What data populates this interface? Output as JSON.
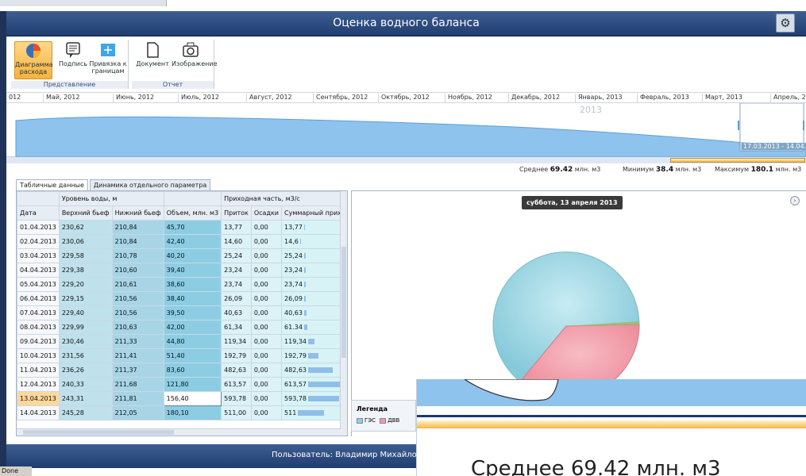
{
  "app": {
    "title": "Оценка водного баланса"
  },
  "ribbon": {
    "buttons": [
      {
        "label": "Диаграмма расхода",
        "icon": "pie-chart-icon"
      },
      {
        "label": "Подпись",
        "icon": "caption-icon"
      },
      {
        "label": "Привязка к границам",
        "icon": "snap-bounds-icon"
      },
      {
        "label": "Документ",
        "icon": "document-icon"
      },
      {
        "label": "Изображение",
        "icon": "camera-icon"
      }
    ],
    "groups": [
      "Представление",
      "Отчет"
    ]
  },
  "timeline": {
    "months": [
      "012",
      "Май, 2012",
      "Июнь, 2012",
      "Июль, 2012",
      "Август, 2012",
      "Сентябрь, 2012",
      "Октябрь, 2012",
      "Ноябрь, 2012",
      "Декабрь, 2012",
      "Январь, 2013",
      "Февраль, 2013",
      "Март, 2013",
      "Апрель, 2"
    ],
    "year_label": "2013",
    "range_label": "17.03.2013 - 14.04.",
    "stats": {
      "avg_label": "Среднее",
      "avg_value": "69.42",
      "avg_unit": "млн. м3",
      "min_label": "Минимум",
      "min_value": "38.4",
      "min_unit": "млн. м3",
      "max_label": "Максимум",
      "max_value": "180.1",
      "max_unit": "млн. м3"
    }
  },
  "tabs": [
    "Табличные данные",
    "Динамика отдельного параметра"
  ],
  "table": {
    "group_headers": {
      "levels": "Уровень воды, м",
      "inflow": "Приходная часть, м3/с"
    },
    "columns": [
      "Дата",
      "Верхний бьеф",
      "Нижний бьеф",
      "Объем, млн. м3",
      "Приток",
      "Осадки",
      "Суммарный приход"
    ],
    "rows": [
      [
        "01.04.2013",
        "230,62",
        "210,84",
        "45,70",
        "13,77",
        "0,00",
        "13,77"
      ],
      [
        "02.04.2013",
        "230,06",
        "210,84",
        "42,40",
        "14,60",
        "0,00",
        "14,6"
      ],
      [
        "03.04.2013",
        "229,58",
        "210,78",
        "40,20",
        "25,24",
        "0,00",
        "25,24"
      ],
      [
        "04.04.2013",
        "229,38",
        "210,60",
        "39,40",
        "23,24",
        "0,00",
        "23,24"
      ],
      [
        "05.04.2013",
        "229,20",
        "210,61",
        "38,60",
        "23,74",
        "0,00",
        "23,74"
      ],
      [
        "06.04.2013",
        "229,15",
        "210,56",
        "38,40",
        "26,09",
        "0,00",
        "26,09"
      ],
      [
        "07.04.2013",
        "229,40",
        "210,56",
        "39,50",
        "40,63",
        "0,00",
        "40,63"
      ],
      [
        "08.04.2013",
        "229,99",
        "210,63",
        "42,00",
        "61,34",
        "0,00",
        "61.34"
      ],
      [
        "09.04.2013",
        "230,46",
        "211,33",
        "44,80",
        "119,34",
        "0,00",
        "119,34"
      ],
      [
        "10.04.2013",
        "231,56",
        "211,41",
        "51,40",
        "192,79",
        "0,00",
        "192,79"
      ],
      [
        "11.04.2013",
        "236,26",
        "211,37",
        "83,60",
        "482,63",
        "0,00",
        "482,63"
      ],
      [
        "12.04.2013",
        "240,33",
        "211,68",
        "121,80",
        "613,57",
        "0,00",
        "613,57"
      ],
      [
        "13.04.2013",
        "243,31",
        "211,81",
        "156,40",
        "593,78",
        "0,00",
        "593,78"
      ],
      [
        "14.04.2013",
        "245,28",
        "212,05",
        "180,10",
        "511,00",
        "0,00",
        "511"
      ]
    ],
    "inflow_bars": [
      13.77,
      14.6,
      25.24,
      23.24,
      23.74,
      26.09,
      40.63,
      61.34,
      119.34,
      192.79,
      482.63,
      613.57,
      593.78,
      511
    ],
    "selected_row": 12
  },
  "pie_panel": {
    "date_badge": "суббота, 13 апреля 2013",
    "legend_title": "Легенда",
    "legend_items": [
      "ГЭС",
      "ДВВ"
    ]
  },
  "zoom": {
    "text": "Среднее  69.42  млн. м3"
  },
  "status": {
    "user": "Пользователь: Владимир Михайло",
    "done": "Done"
  },
  "colors": {
    "header": "#203d6e",
    "pie_blue": "#8fd0df",
    "pie_pink": "#f29aa6",
    "accent_orange": "#f6b23d",
    "area": "#8ec3ee"
  }
}
